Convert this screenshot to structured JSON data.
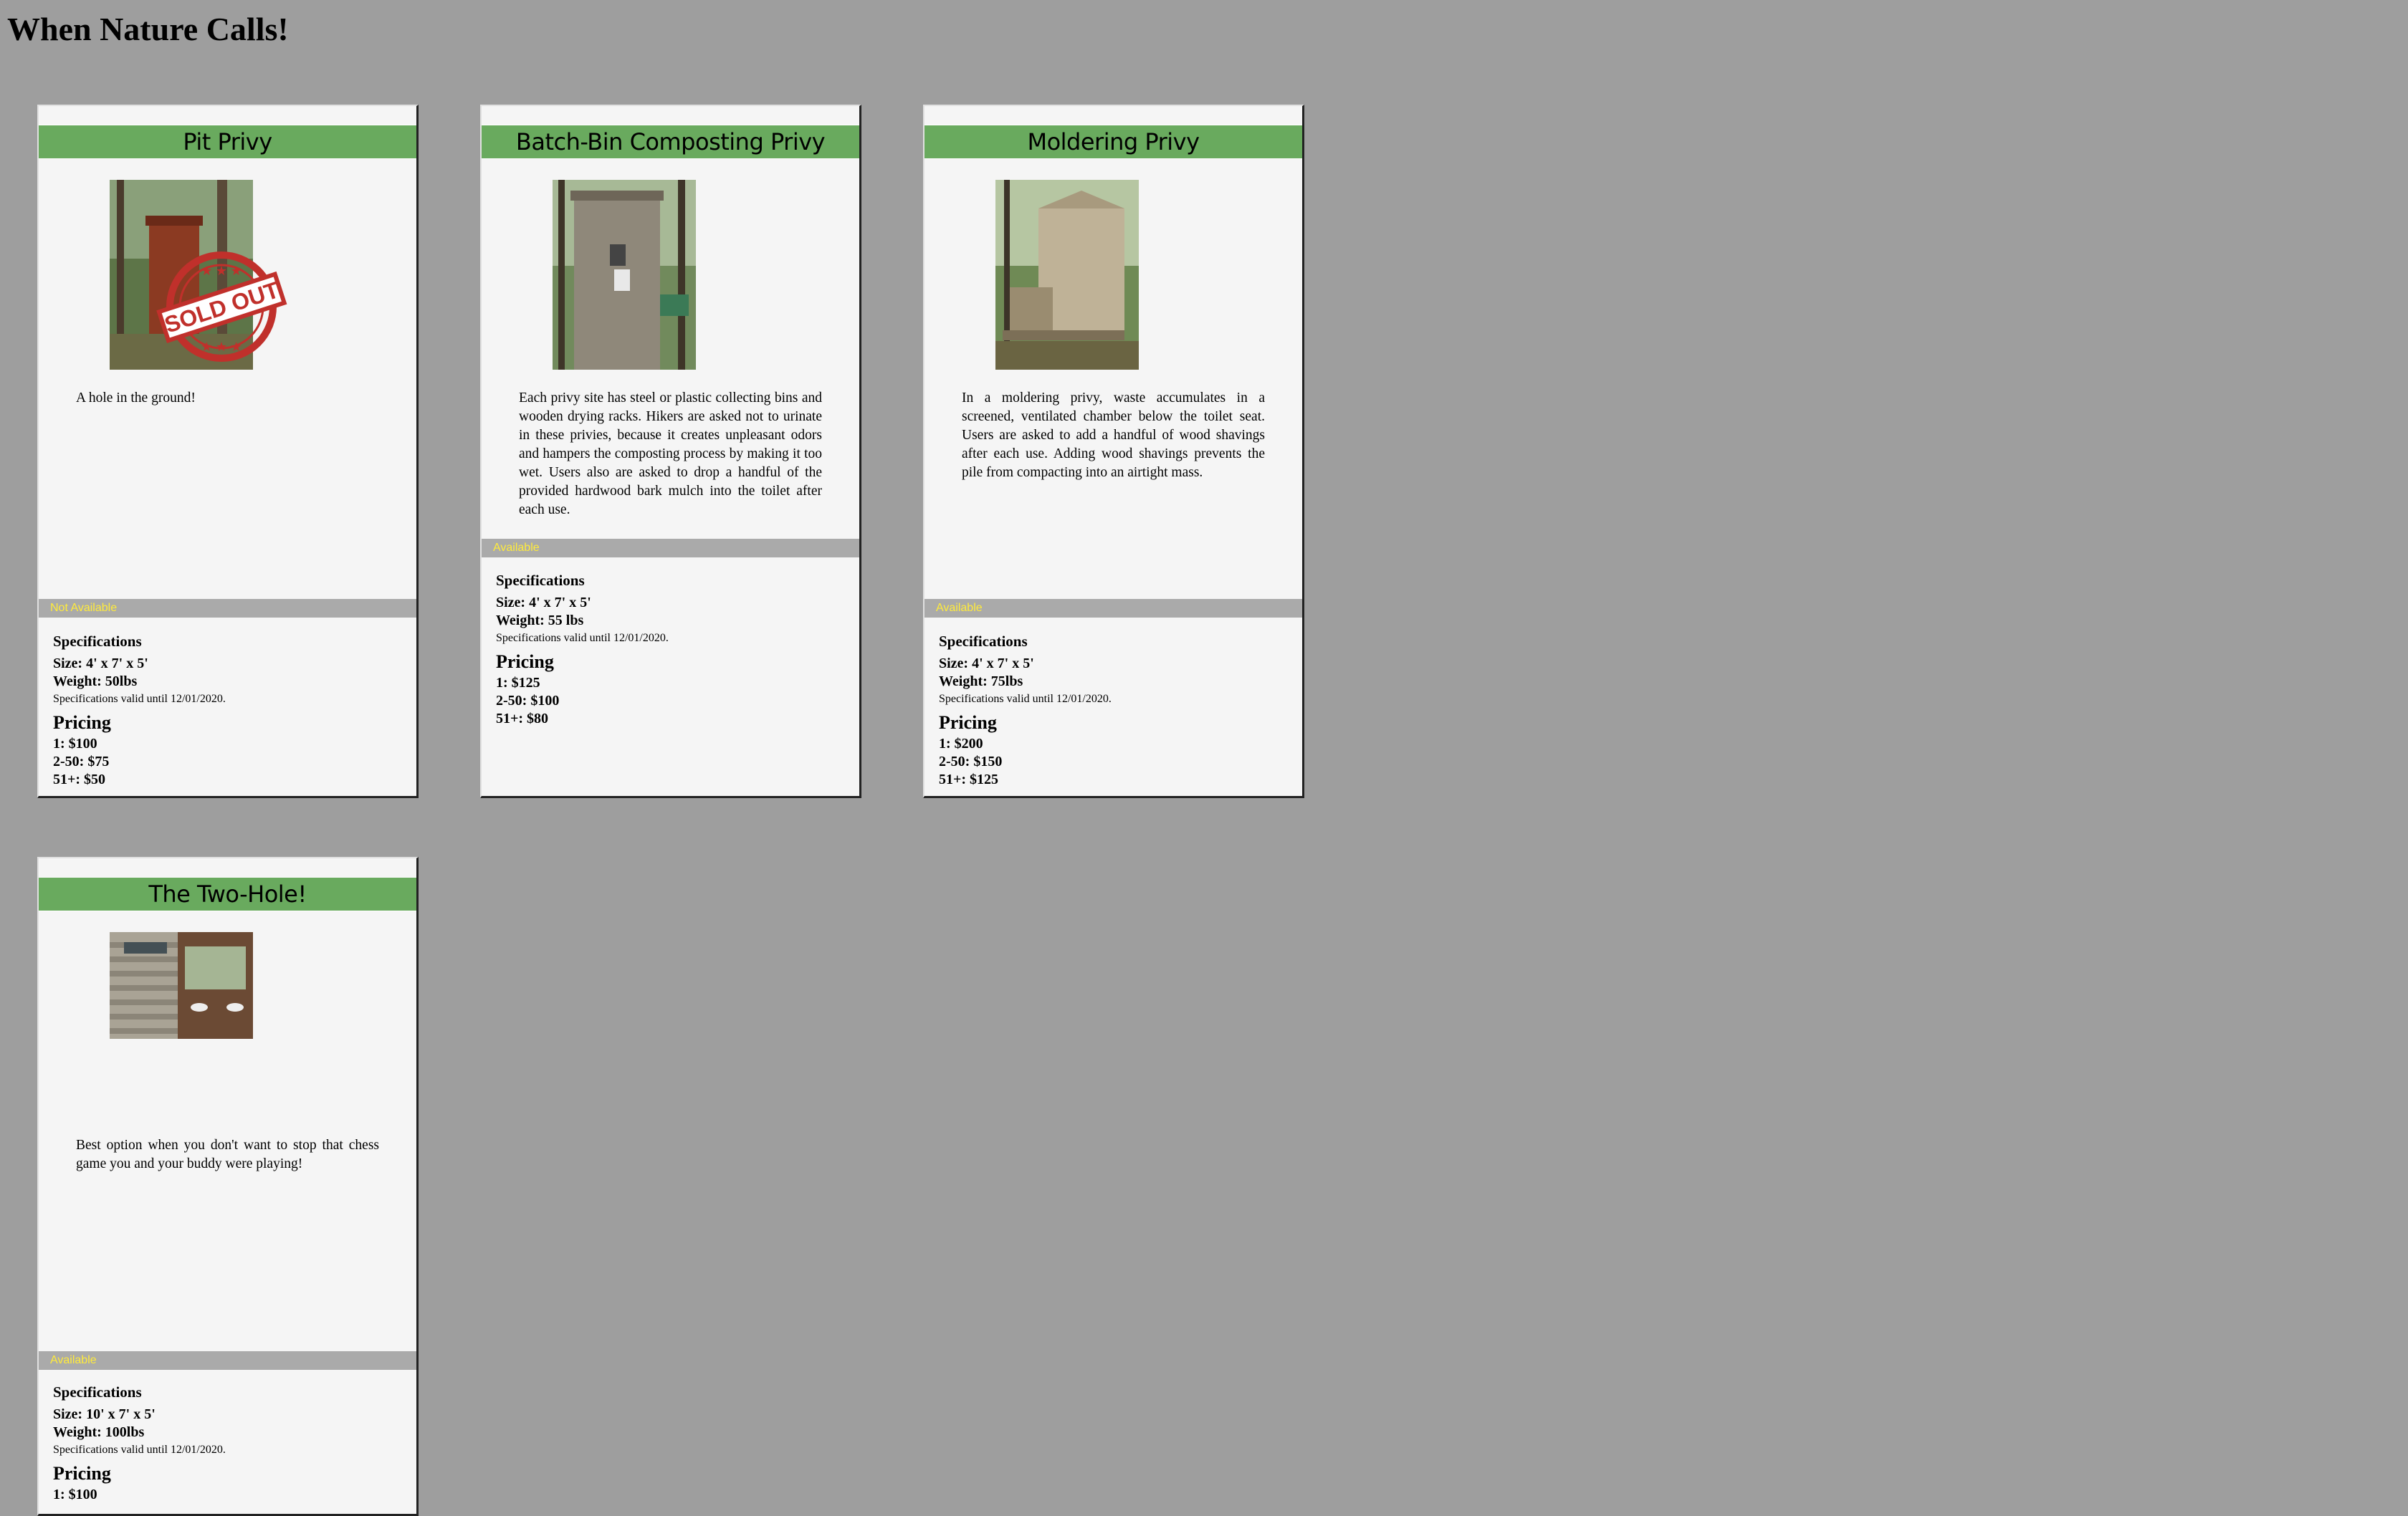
{
  "page": {
    "title": "When Nature Calls!"
  },
  "cards": [
    {
      "title": "Pit Privy",
      "description": "A hole in the ground!",
      "status": "Not Available",
      "badge": "SOLD OUT",
      "specs_heading": "Specifications",
      "size": "Size: 4' x 7' x 5'",
      "weight": "Weight: 50lbs",
      "valid": "Specifications valid until 12/01/2020.",
      "pricing_heading": "Pricing",
      "prices": [
        "1: $100",
        "2-50: $75",
        "51+: $50"
      ]
    },
    {
      "title": "Batch-Bin Composting Privy",
      "description": "Each privy site has steel or plastic collecting bins and wooden drying racks. Hikers are asked not to urinate in these privies, because it creates unpleasant odors and hampers the composting process by making it too wet. Users also are asked to drop a handful of the provided hardwood bark mulch into the toilet after each use.",
      "status": "Available",
      "specs_heading": "Specifications",
      "size": "Size: 4' x 7' x 5'",
      "weight": "Weight: 55 lbs",
      "valid": "Specifications valid until 12/01/2020.",
      "pricing_heading": "Pricing",
      "prices": [
        "1: $125",
        "2-50: $100",
        "51+: $80"
      ]
    },
    {
      "title": "Moldering Privy",
      "description": "In a moldering privy, waste accumulates in a screened, ventilated chamber below the toilet seat. Users are asked to add a handful of wood shavings after each use. Adding wood shavings prevents the pile from compacting into an airtight mass.",
      "status": "Available",
      "specs_heading": "Specifications",
      "size": "Size: 4' x 7' x 5'",
      "weight": "Weight: 75lbs",
      "valid": "Specifications valid until 12/01/2020.",
      "pricing_heading": "Pricing",
      "prices": [
        "1: $200",
        "2-50: $150",
        "51+: $125"
      ]
    },
    {
      "title": "The Two-Hole!",
      "description": "Best option when you don't want to stop that chess game you and your buddy were playing!",
      "status": "Available",
      "specs_heading": "Specifications",
      "size": "Size: 10' x 7' x 5'",
      "weight": "Weight: 100lbs",
      "valid": "Specifications valid until 12/01/2020.",
      "pricing_heading": "Pricing",
      "prices": [
        "1: $100"
      ]
    }
  ],
  "colors": {
    "background": "#9e9e9e",
    "card": "#f5f5f5",
    "title_bar": "#69aa5e",
    "status_bar": "#aaaaaa",
    "status_text": "#ffeb3b",
    "sold_out_red": "#c0302b"
  }
}
